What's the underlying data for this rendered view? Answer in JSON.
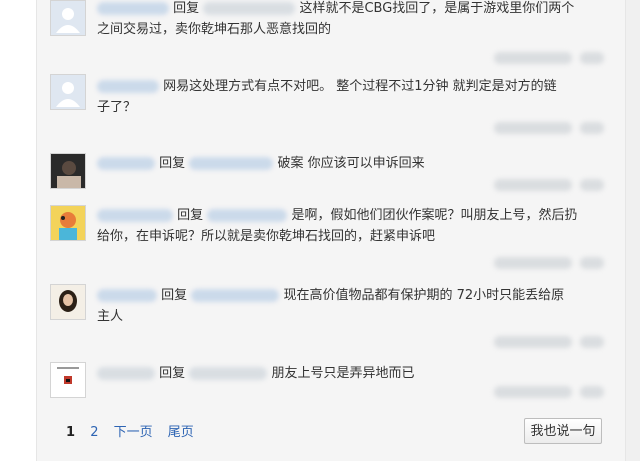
{
  "comments": [
    {
      "reply_word": "回复",
      "text_lines": [
        "这样就不是CBG找回了，是属于游戏里你们两个",
        "之间交易过，卖你乾坤石那人恶意找回的"
      ]
    },
    {
      "reply_word": "",
      "text_lines": [
        "网易这处理方式有点不对吧。 整个过程不过1分钟 就判定是对方的链",
        "子了？"
      ]
    },
    {
      "reply_word": "回复",
      "text_lines": [
        "破案 你应该可以申诉回来"
      ]
    },
    {
      "reply_word": "回复",
      "text_lines": [
        "是啊，假如他们团伙作案呢？叫朋友上号，然后扔",
        "给你，在申诉呢？所以就是卖你乾坤石找回的，赶紧申诉吧"
      ]
    },
    {
      "reply_word": "回复",
      "text_lines": [
        "现在高价值物品都有保护期的 72小时只能丢给原",
        "主人"
      ]
    },
    {
      "reply_word": "回复",
      "text_lines": [
        "朋友上号只是弄异地而已"
      ]
    }
  ],
  "pagination": {
    "current": "1",
    "page2": "2",
    "next": "下一页",
    "last": "尾页"
  },
  "reply_button": "我也说一句",
  "colors": {
    "link": "#2d64b3",
    "blur_name": "#c9d9ea",
    "panel_bg": "#f5f5f5"
  }
}
